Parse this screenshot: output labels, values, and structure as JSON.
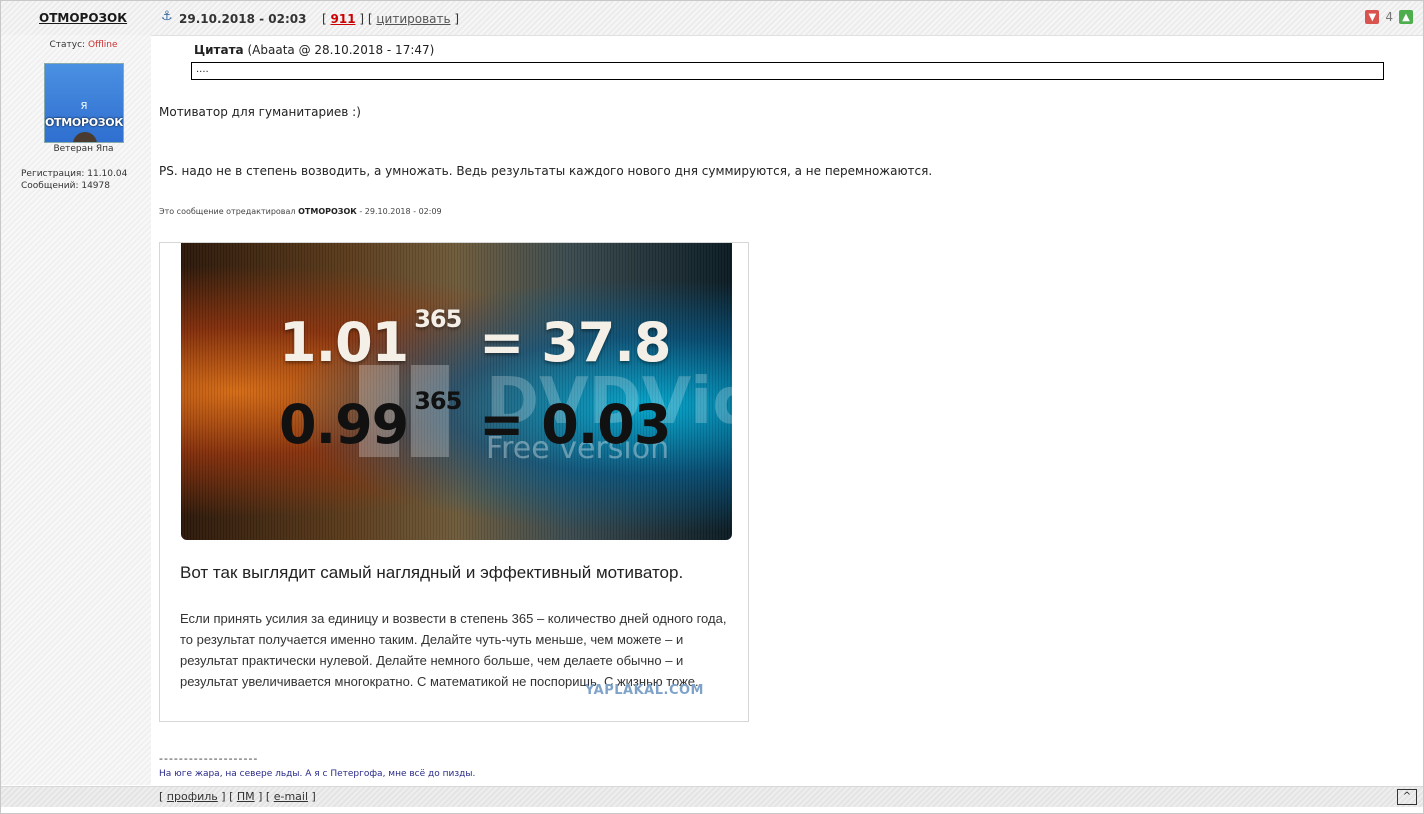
{
  "header": {
    "author": "ОТМОРОЗОК",
    "date": "29.10.2018 - 02:03",
    "post_number": "911",
    "quote_link": "цитировать",
    "rating_value": "4"
  },
  "sidebar": {
    "status_label": "Статус:",
    "status_value": "Offline",
    "avatar_text_1": "Я",
    "avatar_text_2": "ОТМОРОЗОК",
    "rank": "Ветеран Япа",
    "registration": "Регистрация: 11.10.04",
    "messages": "Сообщений: 14978"
  },
  "post": {
    "quote_title": "Цитата",
    "quote_meta": "(Abaata @ 28.10.2018 - 17:47)",
    "quote_text": "....",
    "text_1": "Мотиватор для гуманитариев :)",
    "text_2": "PS. надо не в степень возводить, а умножать. Ведь результаты каждого нового дня суммируются, а не перемножаются.",
    "edited_prefix": "Это сообщение отредактировал",
    "edited_author": "ОТМОРОЗОК",
    "edited_date": "- 29.10.2018 - 02:09"
  },
  "image_card": {
    "eq1_base": "1.01",
    "eq1_exp": "365",
    "eq1_result": "= 37.8",
    "eq2_base": "0.99",
    "eq2_exp": "365",
    "eq2_result": "= 0.03",
    "watermark_1": "DVDVideo",
    "watermark_2": "Free version",
    "title": "Вот так выглядит самый наглядный и эффективный мотиватор.",
    "body": "Если принять усилия за единицу и возвести в степень 365 – количество дней одного года, то результат получается именно таким. Делайте чуть-чуть меньше, чем можете – и результат практически нулевой. Делайте немного больше, чем делаете обычно – и результат увеличивается многократно. С математикой не поспоришь. С жизнью тоже.",
    "site_watermark": "YAPLAKAL.COM"
  },
  "signature": {
    "separator": "--------------------",
    "text": "На юге жара, на севере льды. А я с Петергофа, мне всё до пизды."
  },
  "footer": {
    "profile": "профиль",
    "pm": "ПМ",
    "email": "e-mail",
    "top_glyph": "^"
  }
}
